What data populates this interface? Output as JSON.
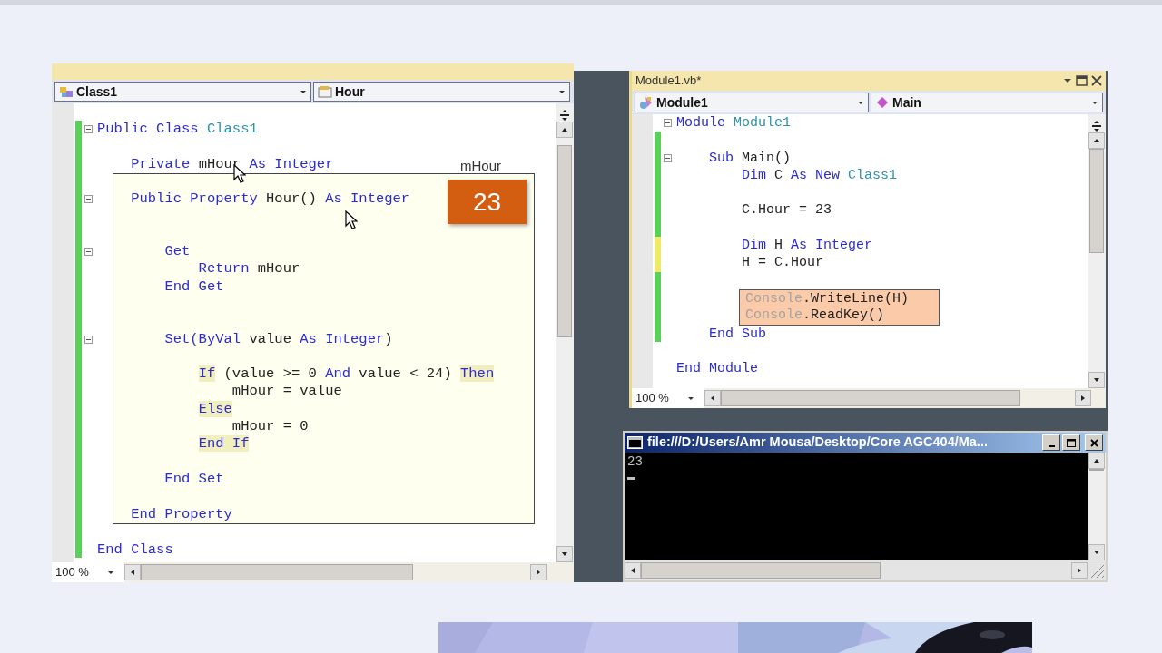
{
  "class_window": {
    "dropdowns": [
      {
        "kind": "class",
        "label": "Class1"
      },
      {
        "kind": "property",
        "label": "Hour"
      }
    ],
    "lines": [
      {
        "color": "#5ad05a",
        "fold": true,
        "tokens": [
          {
            "kind": "keyword",
            "text": "Public Class "
          },
          {
            "kind": "type",
            "text": "Class1"
          }
        ]
      },
      {
        "color": "#5ad05a"
      },
      {
        "color": "#5ad05a",
        "tokens": [
          {
            "kind": "keyword",
            "text": "    Private "
          },
          {
            "kind": "plain",
            "text": "mHour "
          },
          {
            "kind": "keyword",
            "text": "As Integer"
          }
        ]
      },
      {
        "color": "#5ad05a",
        "boxed": true
      },
      {
        "color": "#5ad05a",
        "boxed": true,
        "fold": true,
        "tokens": [
          {
            "kind": "keyword",
            "text": "    Public Property "
          },
          {
            "kind": "plain",
            "text": "Hour() "
          },
          {
            "kind": "keyword",
            "text": "As Integer"
          }
        ]
      },
      {
        "color": "#5ad05a",
        "boxed": true
      },
      {
        "color": "#5ad05a",
        "boxed": true
      },
      {
        "color": "#5ad05a",
        "boxed": true,
        "fold": true,
        "tokens": [
          {
            "kind": "keyword",
            "text": "        Get"
          }
        ]
      },
      {
        "color": "#5ad05a",
        "boxed": true,
        "tokens": [
          {
            "kind": "keyword",
            "text": "            Return "
          },
          {
            "kind": "plain",
            "text": "mHour"
          }
        ]
      },
      {
        "color": "#5ad05a",
        "boxed": true,
        "tokens": [
          {
            "kind": "keyword",
            "text": "        End Get"
          }
        ]
      },
      {
        "color": "#5ad05a",
        "boxed": true
      },
      {
        "color": "#5ad05a",
        "boxed": true
      },
      {
        "color": "#5ad05a",
        "boxed": true,
        "fold": true,
        "tokens": [
          {
            "kind": "keyword",
            "text": "        Set(ByVal "
          },
          {
            "kind": "plain",
            "text": "value "
          },
          {
            "kind": "keyword",
            "text": "As Integer"
          },
          {
            "kind": "plain",
            "text": ")"
          }
        ]
      },
      {
        "color": "#5ad05a",
        "boxed": true
      },
      {
        "color": "#5ad05a",
        "boxed": true,
        "tokens": [
          {
            "kind": "keyword",
            "text": "            If",
            "highlight": true
          },
          {
            "kind": "plain",
            "text": " (value >= 0 "
          },
          {
            "kind": "keyword",
            "text": "And"
          },
          {
            "kind": "plain",
            "text": " value < 24) "
          },
          {
            "kind": "keyword",
            "text": "Then",
            "highlight": true
          }
        ]
      },
      {
        "color": "#5ad05a",
        "boxed": true,
        "tokens": [
          {
            "kind": "plain",
            "text": "                mHour = value"
          }
        ]
      },
      {
        "color": "#5ad05a",
        "boxed": true,
        "tokens": [
          {
            "kind": "keyword",
            "text": "            Else",
            "highlight": true
          }
        ]
      },
      {
        "color": "#5ad05a",
        "boxed": true,
        "tokens": [
          {
            "kind": "plain",
            "text": "                mHour = 0"
          }
        ]
      },
      {
        "color": "#5ad05a",
        "boxed": true,
        "tokens": [
          {
            "kind": "keyword",
            "text": "            End If",
            "highlight": true
          }
        ]
      },
      {
        "color": "#5ad05a",
        "boxed": true
      },
      {
        "color": "#5ad05a",
        "boxed": true,
        "tokens": [
          {
            "kind": "keyword",
            "text": "        End Set"
          }
        ]
      },
      {
        "color": "#5ad05a",
        "boxed": true
      },
      {
        "color": "#5ad05a",
        "boxed": true,
        "tokens": [
          {
            "kind": "keyword",
            "text": "    End Property"
          }
        ]
      },
      {
        "color": "#5ad05a"
      },
      {
        "color": "#5ad05a",
        "tokens": [
          {
            "kind": "keyword",
            "text": "End Class"
          }
        ]
      }
    ],
    "zoom": "100 %",
    "annotation_label": "mHour",
    "annotation_value": "23"
  },
  "module_window": {
    "title": "Module1.vb*",
    "dropdowns": [
      {
        "kind": "module",
        "label": "Module1"
      },
      {
        "kind": "method",
        "label": "Main"
      }
    ],
    "lines": [
      {
        "fold": true,
        "tokens": [
          {
            "kind": "keyword",
            "text": "Module "
          },
          {
            "kind": "type",
            "text": "Module1"
          }
        ]
      },
      {
        "color": "#5ad05a"
      },
      {
        "color": "#5ad05a",
        "fold": true,
        "tokens": [
          {
            "kind": "keyword",
            "text": "    Sub "
          },
          {
            "kind": "plain",
            "text": "Main()"
          }
        ]
      },
      {
        "color": "#5ad05a",
        "tokens": [
          {
            "kind": "keyword",
            "text": "        Dim "
          },
          {
            "kind": "plain",
            "text": "C "
          },
          {
            "kind": "keyword",
            "text": "As New "
          },
          {
            "kind": "type",
            "text": "Class1"
          }
        ]
      },
      {
        "color": "#5ad05a"
      },
      {
        "color": "#5ad05a",
        "tokens": [
          {
            "kind": "plain",
            "text": "        C.Hour = 23"
          }
        ]
      },
      {
        "color": "#5ad05a"
      },
      {
        "color": "#eee96a",
        "tokens": [
          {
            "kind": "keyword",
            "text": "        Dim "
          },
          {
            "kind": "plain",
            "text": "H "
          },
          {
            "kind": "keyword",
            "text": "As Integer"
          }
        ]
      },
      {
        "color": "#eee96a",
        "tokens": [
          {
            "kind": "plain",
            "text": "        H = C.Hour"
          }
        ]
      },
      {
        "color": "#5ad05a"
      },
      {
        "color": "#5ad05a",
        "boxed": true,
        "tokens": [
          {
            "kind": "dim",
            "text": "Console"
          },
          {
            "kind": "plain",
            "text": ".WriteLine(H)"
          }
        ]
      },
      {
        "color": "#5ad05a",
        "boxed": true,
        "tokens": [
          {
            "kind": "dim",
            "text": "Console"
          },
          {
            "kind": "plain",
            "text": ".ReadKey()"
          }
        ]
      },
      {
        "color": "#5ad05a",
        "tokens": [
          {
            "kind": "keyword",
            "text": "    End Sub"
          }
        ]
      },
      {
        "boxed": false
      },
      {
        "tokens": [
          {
            "kind": "keyword",
            "text": "End Module"
          }
        ]
      }
    ],
    "zoom": "100 %"
  },
  "console_window": {
    "title": "file:///D:/Users/Amr Mousa/Desktop/Core AGC404/Ma...",
    "output": [
      "23"
    ]
  }
}
